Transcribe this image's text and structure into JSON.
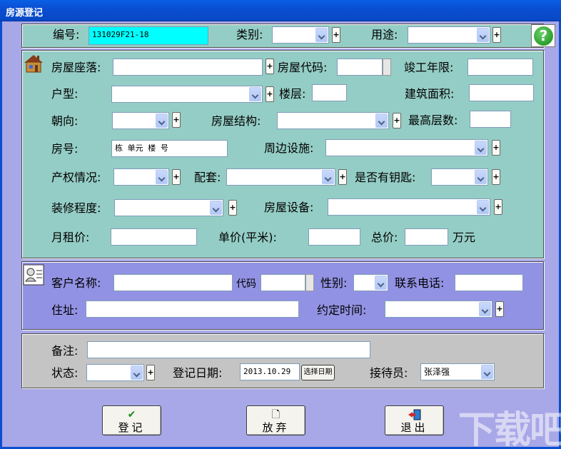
{
  "window": {
    "title": "房源登记"
  },
  "top_bar": {
    "number_label": "编号:",
    "number_value": "131029F21-18",
    "category_label": "类别:",
    "category_value": "",
    "usage_label": "用途:",
    "usage_value": "",
    "plus": "+"
  },
  "house": {
    "location_label": "房屋座落:",
    "location_value": "",
    "code_label": "房屋代码:",
    "code_value": "",
    "completion_label": "竣工年限:",
    "completion_value": "",
    "layout_label": "户型:",
    "layout_value": "",
    "floor_label": "楼层:",
    "floor_value": "",
    "area_label": "建筑面积:",
    "area_value": "",
    "orientation_label": "朝向:",
    "orientation_value": "",
    "structure_label": "房屋结构:",
    "structure_value": "",
    "max_floors_label": "最高层数:",
    "max_floors_value": "",
    "room_no_label": "房号:",
    "room_no_value": "栋 单元 楼 号",
    "facilities_label": "周边设施:",
    "facilities_value": "",
    "ownership_label": "产权情况:",
    "ownership_value": "",
    "supporting_label": "配套:",
    "supporting_value": "",
    "key_label": "是否有钥匙:",
    "key_value": "",
    "decoration_label": "装修程度:",
    "decoration_value": "",
    "equipment_label": "房屋设备:",
    "equipment_value": "",
    "rent_label": "月租价:",
    "rent_value": "",
    "unit_price_label": "单价(平米):",
    "unit_price_value": "",
    "total_label": "总价:",
    "total_value": "",
    "total_unit": "万元"
  },
  "client": {
    "name_label": "客户名称:",
    "name_value": "",
    "code_label": "代码",
    "code_value": "",
    "gender_label": "性别:",
    "gender_value": "",
    "phone_label": "联系电话:",
    "phone_value": "",
    "address_label": "住址:",
    "address_value": "",
    "appointment_label": "约定时间:",
    "appointment_value": ""
  },
  "footer_panel": {
    "remarks_label": "备注:",
    "remarks_value": "",
    "status_label": "状态:",
    "status_value": "",
    "reg_date_label": "登记日期:",
    "reg_date_value": "2013.10.29",
    "pick_date_label": "选择日期",
    "receptionist_label": "接待员:",
    "receptionist_value": "张泽强"
  },
  "buttons": {
    "register": "登记",
    "discard": "放弃",
    "exit": "退出"
  },
  "icons": {
    "help": "question-mark-icon",
    "house": "house-icon",
    "client": "client-card-icon",
    "register": "checkmark-icon",
    "discard": "blank-document-icon",
    "exit": "exit-door-icon"
  },
  "watermark": {
    "text": "下载吧"
  },
  "colors": {
    "titlebar": "#0a4fd2",
    "window_bg": "#a8a7e7",
    "house_panel": "#94cdc5",
    "client_panel": "#9292e4",
    "footer_panel": "#c4c4c4",
    "number_field": "#00ffff"
  }
}
